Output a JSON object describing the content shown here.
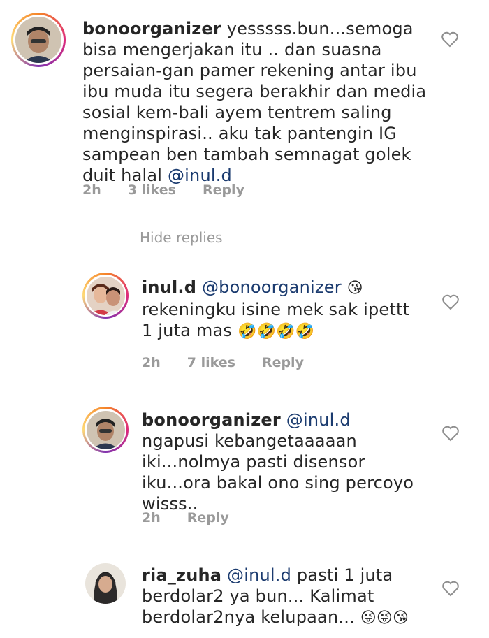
{
  "comments": [
    {
      "username": "bonoorganizer",
      "text": "yesssss.bun...semoga bisa mengerjakan itu .. dan suasna persaian-gan pamer rekening antar ibu ibu muda itu segera berakhir dan media sosial kem-bali ayem tentrem saling menginspirasi.. aku tak pantengin IG sampean ben tambah semnagat golek duit halal",
      "mention": "@inul.d",
      "time": "2h",
      "likes": "3 likes",
      "reply": "Reply"
    },
    {
      "username": "inul.d",
      "mention": "@bonoorganizer",
      "text": "rekeningku isine mek sak ipettt 1 juta mas",
      "emoji_after_mention": "😘",
      "emojis": "🤣🤣🤣🤣",
      "time": "2h",
      "likes": "7 likes",
      "reply": "Reply"
    },
    {
      "username": "bonoorganizer",
      "mention": "@inul.d",
      "text": "ngapusi kebangetaaaaan iki...nolmya pasti disensor iku...ora bakal ono sing percoyo wisss..",
      "time": "2h",
      "reply": "Reply"
    },
    {
      "username": "ria_zuha",
      "mention": "@inul.d",
      "text": "pasti 1 juta berdolar2 ya bun... Kalimat berdolar2nya kelupaan...",
      "emojis": "😜😜😘"
    }
  ],
  "hide_replies": "Hide replies",
  "icons": {
    "heart": "heart-outline-icon"
  },
  "colors": {
    "mention": "#1b3b6f",
    "meta": "#9a9a9a"
  }
}
